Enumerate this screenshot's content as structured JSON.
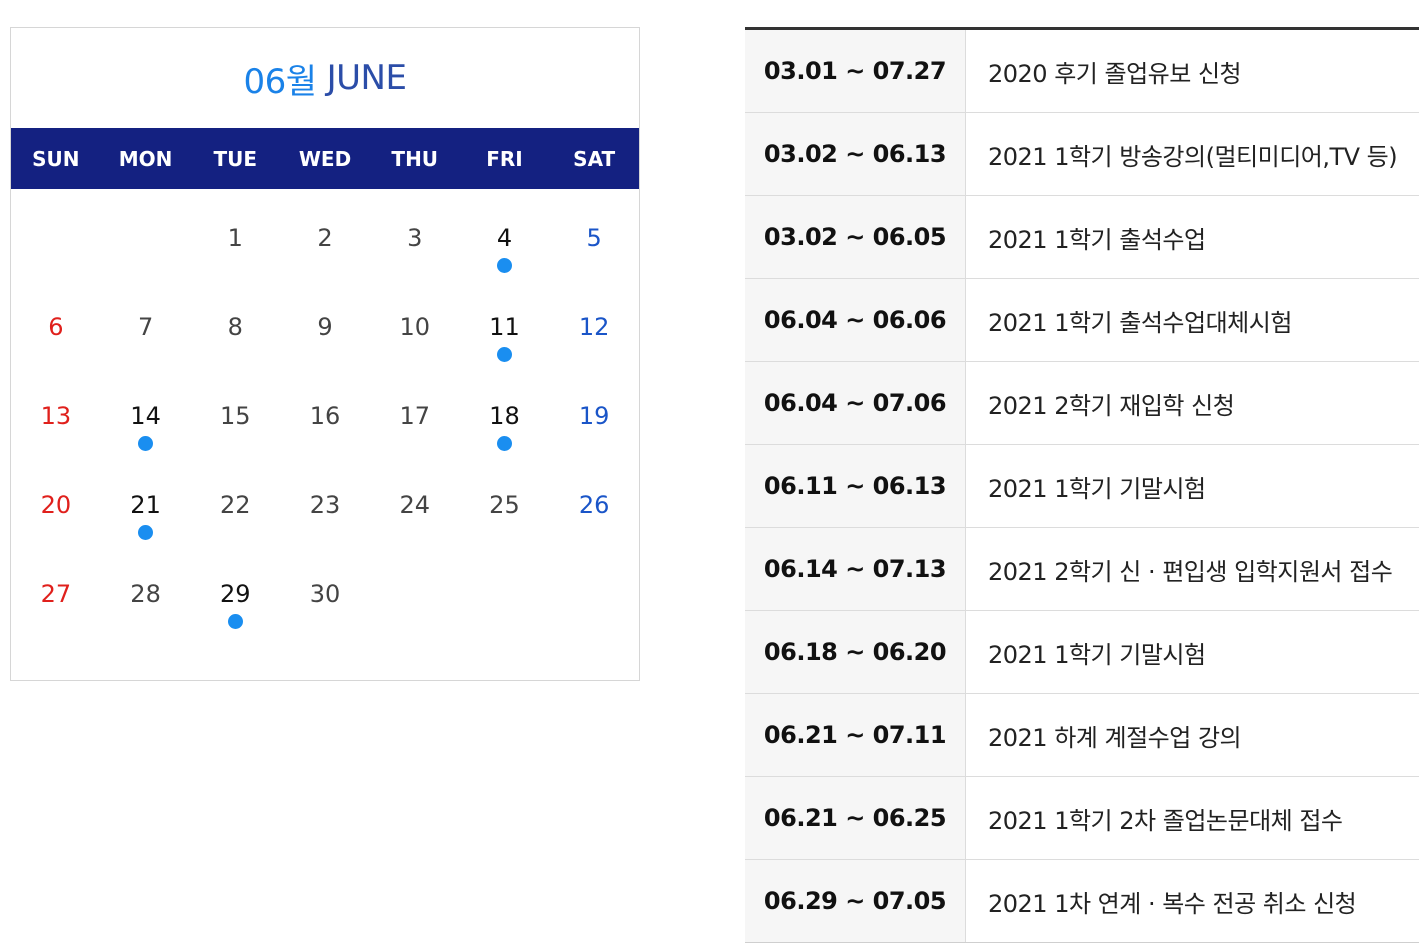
{
  "calendar": {
    "month_label": "06월",
    "month_name": "JUNE",
    "weekdays": [
      "SUN",
      "MON",
      "TUE",
      "WED",
      "THU",
      "FRI",
      "SAT"
    ],
    "weeks": [
      [
        {
          "label": "",
          "event": false
        },
        {
          "label": "",
          "event": false
        },
        {
          "label": "1",
          "event": false
        },
        {
          "label": "2",
          "event": false
        },
        {
          "label": "3",
          "event": false
        },
        {
          "label": "4",
          "event": true
        },
        {
          "label": "5",
          "event": false
        }
      ],
      [
        {
          "label": "6",
          "event": false
        },
        {
          "label": "7",
          "event": false
        },
        {
          "label": "8",
          "event": false
        },
        {
          "label": "9",
          "event": false
        },
        {
          "label": "10",
          "event": false
        },
        {
          "label": "11",
          "event": true
        },
        {
          "label": "12",
          "event": false
        }
      ],
      [
        {
          "label": "13",
          "event": false
        },
        {
          "label": "14",
          "event": true
        },
        {
          "label": "15",
          "event": false
        },
        {
          "label": "16",
          "event": false
        },
        {
          "label": "17",
          "event": false
        },
        {
          "label": "18",
          "event": true
        },
        {
          "label": "19",
          "event": false
        }
      ],
      [
        {
          "label": "20",
          "event": false
        },
        {
          "label": "21",
          "event": true
        },
        {
          "label": "22",
          "event": false
        },
        {
          "label": "23",
          "event": false
        },
        {
          "label": "24",
          "event": false
        },
        {
          "label": "25",
          "event": false
        },
        {
          "label": "26",
          "event": false
        }
      ],
      [
        {
          "label": "27",
          "event": false
        },
        {
          "label": "28",
          "event": false
        },
        {
          "label": "29",
          "event": true
        },
        {
          "label": "30",
          "event": false
        },
        {
          "label": "",
          "event": false
        },
        {
          "label": "",
          "event": false
        },
        {
          "label": "",
          "event": false
        }
      ]
    ]
  },
  "schedule": [
    {
      "dates": "03.01 ~ 07.27",
      "title": "2020 후기 졸업유보 신청"
    },
    {
      "dates": "03.02 ~ 06.13",
      "title": "2021 1학기 방송강의(멀티미디어,TV 등)"
    },
    {
      "dates": "03.02 ~ 06.05",
      "title": "2021 1학기 출석수업"
    },
    {
      "dates": "06.04 ~ 06.06",
      "title": "2021 1학기 출석수업대체시험"
    },
    {
      "dates": "06.04 ~ 07.06",
      "title": "2021 2학기 재입학 신청"
    },
    {
      "dates": "06.11 ~ 06.13",
      "title": "2021 1학기 기말시험"
    },
    {
      "dates": "06.14 ~ 07.13",
      "title": "2021 2학기 신 · 편입생 입학지원서 접수"
    },
    {
      "dates": "06.18 ~ 06.20",
      "title": "2021 1학기 기말시험"
    },
    {
      "dates": "06.21 ~ 07.11",
      "title": "2021 하계 계절수업 강의"
    },
    {
      "dates": "06.21 ~ 06.25",
      "title": "2021 1학기 2차 졸업논문대체 접수"
    },
    {
      "dates": "06.29 ~ 07.05",
      "title": "2021 1차 연계 · 복수 전공 취소 신청"
    }
  ],
  "colors": {
    "header_navy": "#142181",
    "event_dot": "#1a8ef0",
    "sunday_red": "#e0201c",
    "saturday_blue": "#1a55c8",
    "month_blue": "#1a82e8"
  }
}
